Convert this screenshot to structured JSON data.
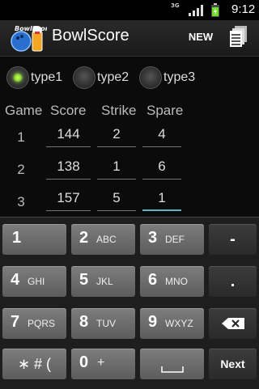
{
  "status": {
    "network": "3G",
    "time": "9:12"
  },
  "app": {
    "title": "BowlScore",
    "logo_text": "BowlScore",
    "new_label": "NEW"
  },
  "types": [
    {
      "label": "type1",
      "checked": true
    },
    {
      "label": "type2",
      "checked": false
    },
    {
      "label": "type3",
      "checked": false
    }
  ],
  "table": {
    "headers": [
      "Game",
      "Score",
      "Strike",
      "Spare"
    ],
    "rows": [
      {
        "game": "1",
        "score": "144",
        "strike": "2",
        "spare": "4"
      },
      {
        "game": "2",
        "score": "138",
        "strike": "1",
        "spare": "6"
      },
      {
        "game": "3",
        "score": "157",
        "strike": "5",
        "spare": "1"
      }
    ]
  },
  "keyboard": {
    "row1": [
      {
        "main": "1",
        "sub": ""
      },
      {
        "main": "2",
        "sub": "ABC"
      },
      {
        "main": "3",
        "sub": "DEF"
      },
      {
        "main": "-",
        "sub": ""
      }
    ],
    "row2": [
      {
        "main": "4",
        "sub": "GHI"
      },
      {
        "main": "5",
        "sub": "JKL"
      },
      {
        "main": "6",
        "sub": "MNO"
      },
      {
        "main": ".",
        "sub": ""
      }
    ],
    "row3": [
      {
        "main": "7",
        "sub": "PQRS"
      },
      {
        "main": "8",
        "sub": "TUV"
      },
      {
        "main": "9",
        "sub": "WXYZ"
      }
    ],
    "row4": [
      {
        "main": "∗ # (",
        "sub": ""
      },
      {
        "main": "0",
        "sub": "+"
      }
    ],
    "next_label": "Next"
  }
}
